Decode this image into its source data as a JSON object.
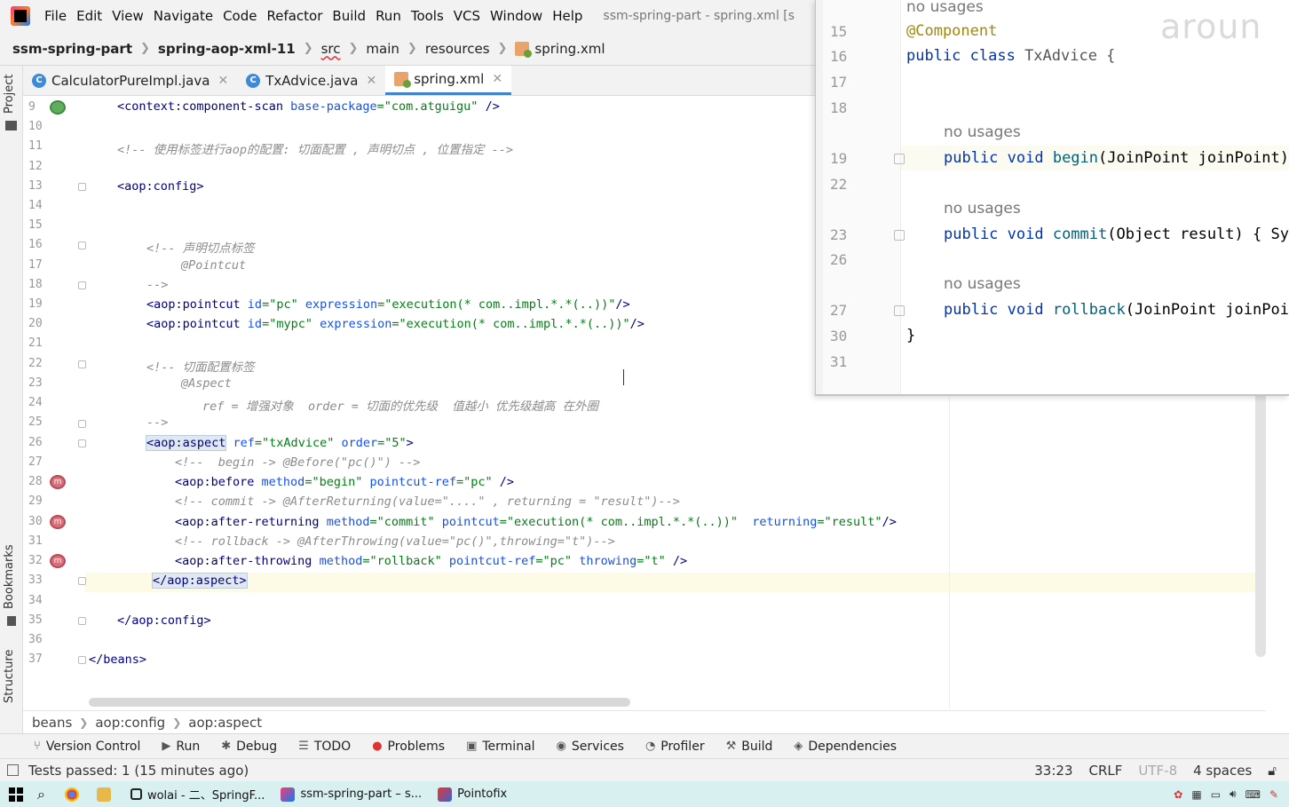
{
  "menubar": {
    "items": [
      "File",
      "Edit",
      "View",
      "Navigate",
      "Code",
      "Refactor",
      "Build",
      "Run",
      "Tools",
      "VCS",
      "Window",
      "Help"
    ],
    "window_title": "ssm-spring-part - spring.xml [s"
  },
  "navbar": {
    "crumbs": [
      "ssm-spring-part",
      "spring-aop-xml-11",
      "src",
      "main",
      "resources",
      "spring.xml"
    ]
  },
  "left_strip": {
    "project": "Project",
    "bookmarks": "Bookmarks",
    "structure": "Structure"
  },
  "tabs": [
    {
      "label": "CalculatorPureImpl.java",
      "icon": "class-icon",
      "active": false
    },
    {
      "label": "TxAdvice.java",
      "icon": "class-icon",
      "active": false
    },
    {
      "label": "spring.xml",
      "icon": "xml-icon",
      "active": true
    }
  ],
  "editor": {
    "line_numbers": [
      "9",
      "10",
      "11",
      "12",
      "13",
      "14",
      "15",
      "16",
      "17",
      "18",
      "19",
      "20",
      "21",
      "22",
      "23",
      "24",
      "25",
      "26",
      "27",
      "28",
      "29",
      "30",
      "31",
      "32",
      "33",
      "34",
      "35",
      "36",
      "37"
    ],
    "lines": {
      "l9": {
        "t1": "<",
        "t2": "context:component-scan",
        "t3": " base-package",
        "t4": "=",
        "t5": "\"com.atguigu\"",
        "t6": " />"
      },
      "l11": "<!-- 使用标签进行aop的配置: 切面配置 , 声明切点 , 位置指定 -->",
      "l13": "<aop:config>",
      "l16": "<!-- 声明切点标签",
      "l17": "@Pointcut",
      "l18": "-->",
      "l19": {
        "a": "<aop:pointcut",
        "b": " id",
        "c": "=\"pc\"",
        "d": " expression",
        "e": "=\"execution(* com..impl.*.*(..))\"",
        "f": "/>"
      },
      "l20": {
        "a": "<aop:pointcut",
        "b": " id",
        "c": "=\"mypc\"",
        "d": " expression",
        "e": "=\"execution(* com..impl.*.*(..))\"",
        "f": "/>"
      },
      "l22": "<!-- 切面配置标签",
      "l23": "@Aspect",
      "l24": "ref = 增强对象  order = 切面的优先级  值越小 优先级越高 在外圈",
      "l25": "-->",
      "l26": {
        "a": "<aop:aspect",
        "b": " ref",
        "c": "=\"txAdvice\"",
        "d": " order",
        "e": "=\"5\"",
        "f": ">"
      },
      "l27": "<!--  begin -> @Before(\"pc()\") -->",
      "l28": {
        "a": "<aop:before",
        "b": " method",
        "c": "=\"begin\"",
        "d": " pointcut-ref",
        "e": "=\"pc\"",
        "f": " />"
      },
      "l29": "<!-- commit -> @AfterReturning(value=\"....\" , returning = \"result\")-->",
      "l30": {
        "a": "<aop:after-returning",
        "b": " method",
        "c": "=\"commit\"",
        "d": " pointcut",
        "e": "=\"execution(* com..impl.*.*(..))\"",
        "g": "  returning",
        "h": "=\"result\"",
        "f": "/>"
      },
      "l31": "<!-- rollback -> @AfterThrowing(value=\"pc()\",throwing=\"t\")-->",
      "l32": {
        "a": "<aop:after-throwing",
        "b": " method",
        "c": "=\"rollback\"",
        "d": " pointcut-ref",
        "e": "=\"pc\"",
        "g": " throwing",
        "h": "=\"t\"",
        "f": " />"
      },
      "l33": "</aop:aspect>",
      "l35": "</aop:config>",
      "l37": "</beans>"
    },
    "gutter_marks": {
      "m28": "m",
      "m30": "m",
      "m32": "m"
    }
  },
  "popup": {
    "line_numbers": [
      "15",
      "16",
      "17",
      "18",
      "19",
      "22",
      "23",
      "26",
      "27",
      "30",
      "31"
    ],
    "no_usages": "no usages",
    "top_hint": "no usages",
    "annotation": "@Component",
    "class_decl": {
      "kw": "public class",
      "name": " TxAdvice {"
    },
    "begin": {
      "kw": "public void",
      "fn": " begin",
      "args": "(JoinPoint joinPoint)"
    },
    "commit": {
      "kw": "public void",
      "fn": " commit",
      "args": "(Object result) { Sy"
    },
    "rollback": {
      "kw": "public void",
      "fn": " rollback",
      "args": "(JoinPoint joinPoi"
    },
    "closing": "}",
    "watermark": "aroun"
  },
  "breadcrumb": [
    "beans",
    "aop:config",
    "aop:aspect"
  ],
  "toolwindows": [
    {
      "label": "Version Control",
      "icon": "branch-icon"
    },
    {
      "label": "Run",
      "icon": "play-icon"
    },
    {
      "label": "Debug",
      "icon": "bug-icon"
    },
    {
      "label": "TODO",
      "icon": "list-icon"
    },
    {
      "label": "Problems",
      "icon": "error-icon"
    },
    {
      "label": "Terminal",
      "icon": "terminal-icon"
    },
    {
      "label": "Services",
      "icon": "services-icon"
    },
    {
      "label": "Profiler",
      "icon": "profiler-icon"
    },
    {
      "label": "Build",
      "icon": "hammer-icon"
    },
    {
      "label": "Dependencies",
      "icon": "dependencies-icon"
    }
  ],
  "statusbar": {
    "message": "Tests passed: 1 (15 minutes ago)",
    "position": "33:23",
    "line_sep": "CRLF",
    "encoding": "UTF-8",
    "indent": "4 spaces"
  },
  "taskbar": {
    "tasks": [
      "wolai - 二、SpringF...",
      "ssm-spring-part – s...",
      "Pointofix"
    ]
  },
  "colors": {
    "accent": "#4083c9",
    "keyword": "#0033b3",
    "string": "#067d17",
    "comment": "#8c8c8c",
    "tag": "#000080"
  }
}
